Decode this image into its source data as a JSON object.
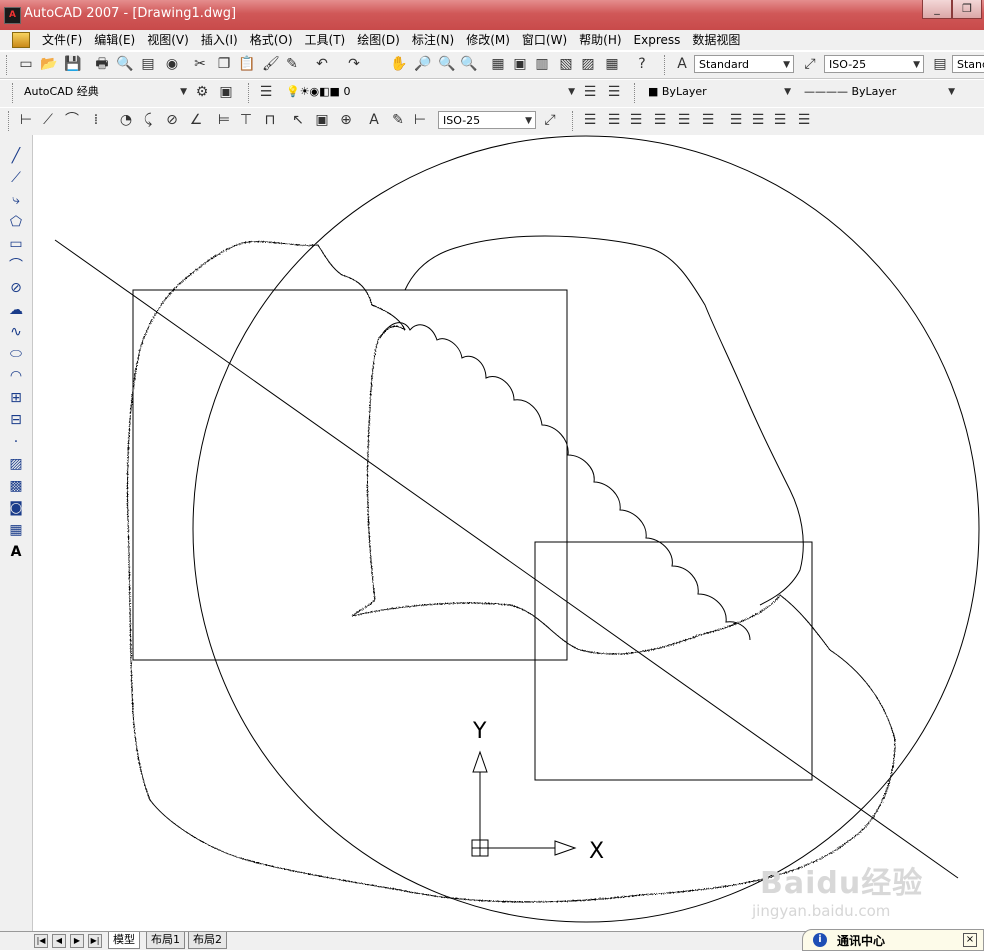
{
  "window": {
    "title": "AutoCAD 2007 - [Drawing1.dwg]",
    "app_icon_text": "A",
    "btn_minimize": "_",
    "btn_restore": "❐"
  },
  "menu": [
    "文件(F)",
    "编辑(E)",
    "视图(V)",
    "插入(I)",
    "格式(O)",
    "工具(T)",
    "绘图(D)",
    "标注(N)",
    "修改(M)",
    "窗口(W)",
    "帮助(H)",
    "Express",
    "数据视图"
  ],
  "toolbar1": {
    "text_style": "Standard",
    "dim_style": "ISO-25",
    "table_style": "Stand"
  },
  "toolbar2": {
    "workspace": "AutoCAD 经典",
    "layer": "0",
    "color": "ByLayer",
    "linetype": "ByLayer"
  },
  "toolbar3": {
    "dim_style": "ISO-25"
  },
  "ucs": {
    "x_label": "X",
    "y_label": "Y"
  },
  "tabs": {
    "model": "模型",
    "layout1": "布局1",
    "layout2": "布局2"
  },
  "nav": [
    "|◀",
    "◀",
    "▶",
    "▶|"
  ],
  "notification": {
    "label": "通讯中心",
    "info_icon": "i",
    "close": "×"
  },
  "watermark": {
    "logo": "Baidu经验",
    "url": "jingyan.baidu.com"
  },
  "icons": {
    "left_toolbar": [
      "line-icon",
      "construction-line-icon",
      "polyline-icon",
      "polygon-icon",
      "rectangle-icon",
      "arc-icon",
      "circle-icon",
      "revision-cloud-icon",
      "spline-icon",
      "ellipse-icon",
      "ellipse-arc-icon",
      "insert-block-icon",
      "make-block-icon",
      "point-icon",
      "hatch-icon",
      "gradient-icon",
      "region-icon",
      "table-icon",
      "multiline-text-icon"
    ]
  }
}
